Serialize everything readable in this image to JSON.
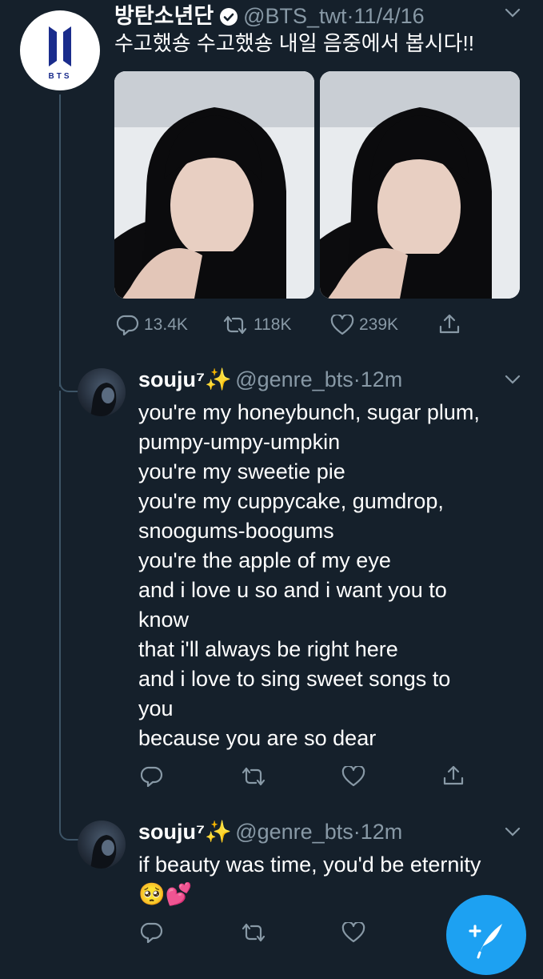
{
  "main_tweet": {
    "display_name": "방탄소년단",
    "handle": "@BTS_twt",
    "separator": "·",
    "date": "11/4/16",
    "text": "수고했숑 수고했숑 내일 음중에서 봅시다!!",
    "logo_text": "BTS",
    "counts": {
      "replies": "13.4K",
      "retweets": "118K",
      "likes": "239K"
    }
  },
  "replies": [
    {
      "display_name": "souju⁷✨",
      "handle": "@genre_bts",
      "separator": "·",
      "time": "12m",
      "lines": [
        "you're my honeybunch, sugar plum,",
        "pumpy-umpy-umpkin",
        "you're my sweetie pie",
        "you're my cuppycake, gumdrop,",
        "snoogums-boogums",
        "you're the apple of my eye",
        "and i love u so and i want you to",
        "know",
        "that i'll always be right here",
        "and i love to sing sweet songs to",
        "you",
        "because you are so dear"
      ]
    },
    {
      "display_name": "souju⁷✨",
      "handle": "@genre_bts",
      "separator": "·",
      "time": "12m",
      "lines": [
        "if beauty was time, you'd be eternity",
        "🥺💕"
      ]
    }
  ],
  "colors": {
    "background": "#15202b",
    "secondary_text": "#8899a6",
    "accent": "#1da1f2"
  },
  "icons": [
    "verified-icon",
    "chevron-down-icon",
    "reply-icon",
    "retweet-icon",
    "like-icon",
    "share-icon",
    "compose-tweet-icon"
  ]
}
